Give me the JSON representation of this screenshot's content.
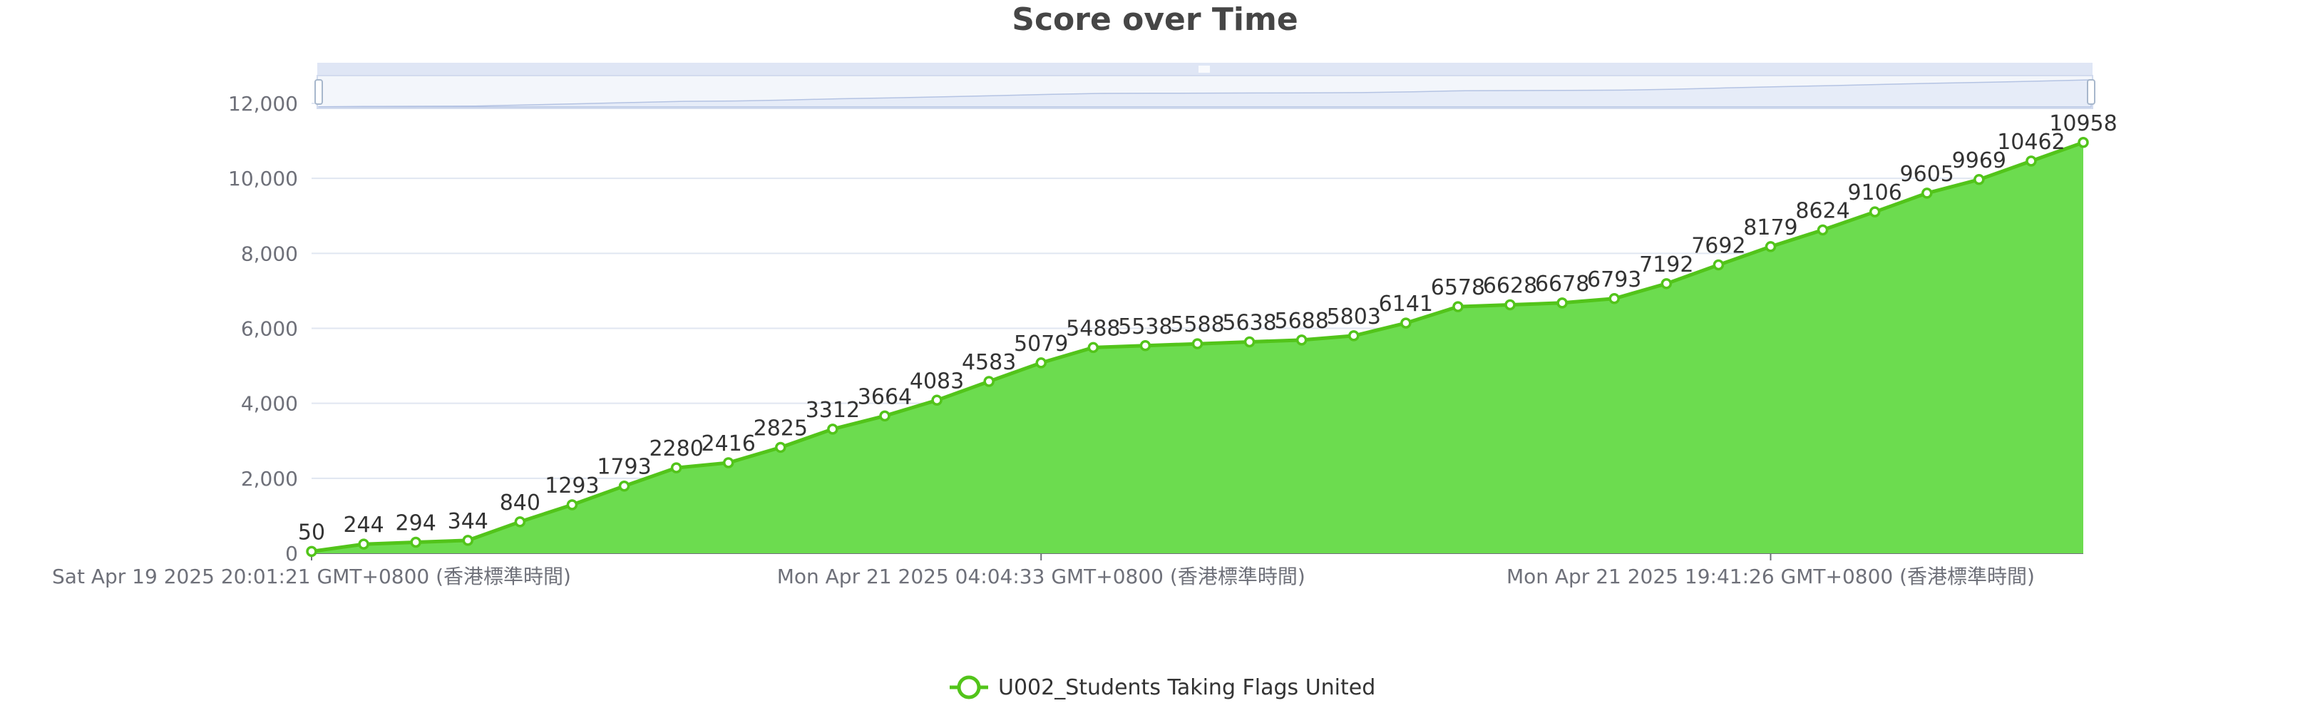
{
  "chart_data": {
    "type": "area",
    "title": "Score over Time",
    "yticks": [
      "0",
      "2,000",
      "4,000",
      "6,000",
      "8,000",
      "10,000",
      "12,000"
    ],
    "ylim": [
      0,
      13000
    ],
    "xticks": [
      {
        "label": "Sat Apr 19 2025 20:01:21 GMT+0800 (香港標準時間)",
        "index": 0
      },
      {
        "label": "Mon Apr 21 2025 04:04:33 GMT+0800 (香港標準時間)",
        "index": 14
      },
      {
        "label": "Mon Apr 21 2025 19:41:26 GMT+0800 (香港標準時間)",
        "index": 28
      }
    ],
    "series": [
      {
        "name": "U002_Students Taking Flags United",
        "color": "#52c41a",
        "fill": "#6cdc4f",
        "values": [
          50,
          244,
          294,
          344,
          840,
          1293,
          1793,
          2280,
          2416,
          2825,
          3312,
          3664,
          4083,
          4583,
          5079,
          5488,
          5538,
          5588,
          5638,
          5688,
          5803,
          6141,
          6578,
          6628,
          6678,
          6793,
          7192,
          7692,
          8179,
          8624,
          9106,
          9605,
          9969,
          10462,
          10958
        ]
      }
    ],
    "grid": true,
    "legend": "bottom-center",
    "datazoom": true
  }
}
